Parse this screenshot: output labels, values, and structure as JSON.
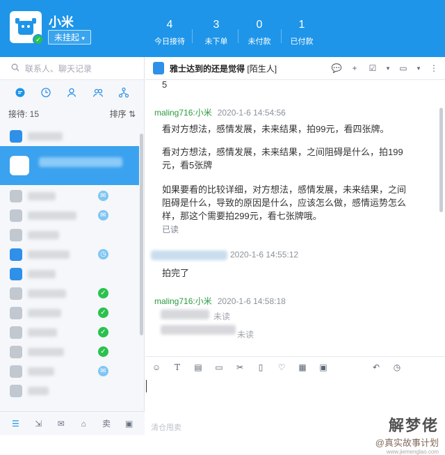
{
  "header": {
    "shop_name": "小米",
    "status_label": "未挂起",
    "stats": [
      {
        "value": "4",
        "label": "今日接待"
      },
      {
        "value": "3",
        "label": "未下单"
      },
      {
        "value": "0",
        "label": "未付款"
      },
      {
        "value": "1",
        "label": "已付款"
      }
    ]
  },
  "sidebar": {
    "search_placeholder": "联系人、聊天记录",
    "reception_label": "接待: 15",
    "sort_label": "排序 ⇅",
    "badges": [
      "◷",
      "✓",
      "✓",
      "✓",
      "✓"
    ]
  },
  "chat": {
    "contact_name": "雅士达到的还是觉得",
    "contact_tag": "[陌生人]",
    "top_fragment": "5",
    "messages": [
      {
        "sender": "maling716:小米",
        "time": "2020-1-6 14:54:56",
        "paragraphs": [
          "看对方想法，感情发展，未来结果，拍99元，看四张牌。",
          "看对方想法，感情发展，未来结果，之间阻碍是什么，拍199元，看5张牌",
          "如果要看的比较详细，对方想法，感情发展，未来结果，之间阻碍是什么，导致的原因是什么，应该怎么做，感情运势怎么样，那这个需要拍299元，看七张牌哦。"
        ],
        "read_label": "已读"
      },
      {
        "sender": "",
        "time": "2020-1-6 14:55:12",
        "text": "拍完了"
      },
      {
        "sender": "maling716:小米",
        "time": "2020-1-6 14:58:18",
        "fragments": [
          "未读",
          "未读"
        ]
      }
    ]
  },
  "input": {
    "hint": "清仓甩卖"
  },
  "watermark": {
    "title": "解梦佬",
    "subtitle": "@真实故事计划",
    "url": "www.jiemenglao.com"
  },
  "colors": {
    "header_bg": "#1e95e8",
    "sender_green": "#2a9a3f",
    "selected_row": "#3aa2ef",
    "badge_green": "#2bc14d"
  }
}
